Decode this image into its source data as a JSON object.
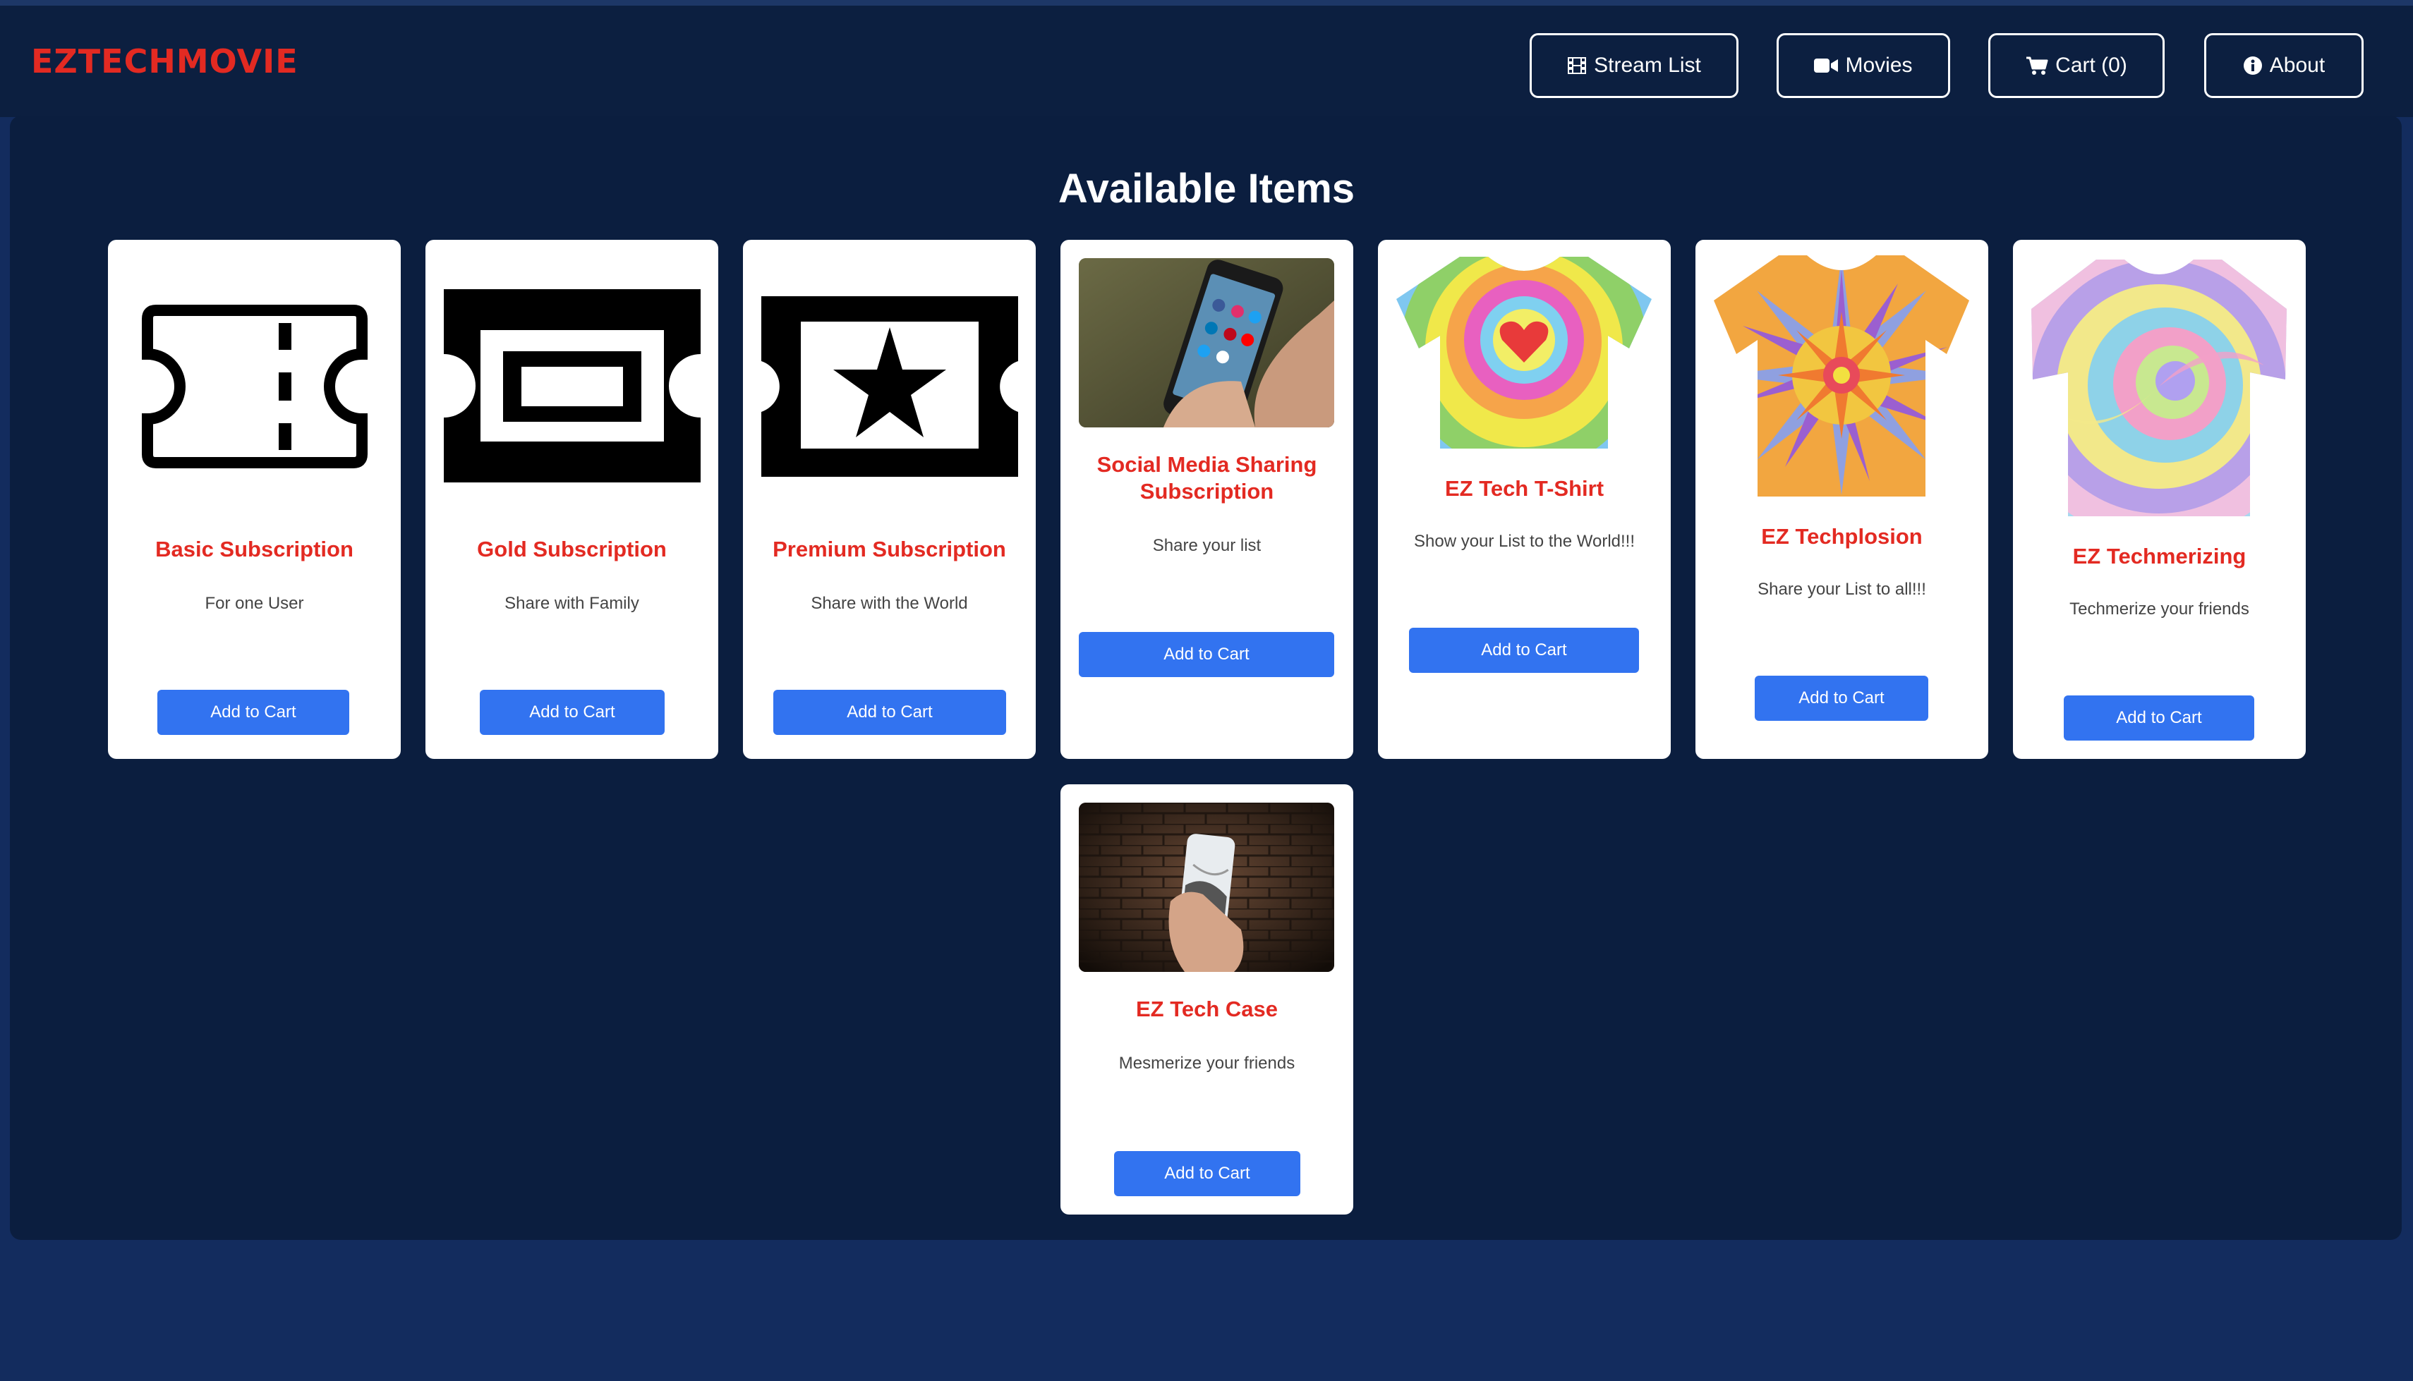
{
  "brand": "EZTECHMOVIE",
  "nav": {
    "stream_list": "Stream List",
    "movies": "Movies",
    "cart": "Cart (0)",
    "about": "About"
  },
  "page": {
    "heading": "Available Items"
  },
  "items": [
    {
      "title": "Basic Subscription",
      "desc": "For one User",
      "button": "Add to Cart",
      "image": "ticket-outline-icon"
    },
    {
      "title": "Gold Subscription",
      "desc": "Share with Family",
      "button": "Add to Cart",
      "image": "ticket-square-icon"
    },
    {
      "title": "Premium Subscription",
      "desc": "Share with the World",
      "button": "Add to Cart",
      "image": "ticket-star-icon"
    },
    {
      "title": "Social Media Sharing Subscription",
      "desc": "Share your list",
      "button": "Add to Cart",
      "image": "phone-social-media-photo"
    },
    {
      "title": "EZ Tech T-Shirt",
      "desc": "Show your List to the World!!!",
      "button": "Add to Cart",
      "image": "tie-dye-heart-shirt"
    },
    {
      "title": "EZ Techplosion",
      "desc": "Share your List to all!!!",
      "button": "Add to Cart",
      "image": "tie-dye-burst-shirt"
    },
    {
      "title": "EZ Techmerizing",
      "desc": "Techmerize your friends",
      "button": "Add to Cart",
      "image": "tie-dye-spiral-shirt"
    },
    {
      "title": "EZ Tech Case",
      "desc": "Mesmerize your friends",
      "button": "Add to Cart",
      "image": "phone-case-brick-photo"
    }
  ],
  "colors": {
    "brand": "#e32a22",
    "accent": "#3273f0",
    "background": "#132c5e",
    "panel": "#0b1e3f"
  }
}
